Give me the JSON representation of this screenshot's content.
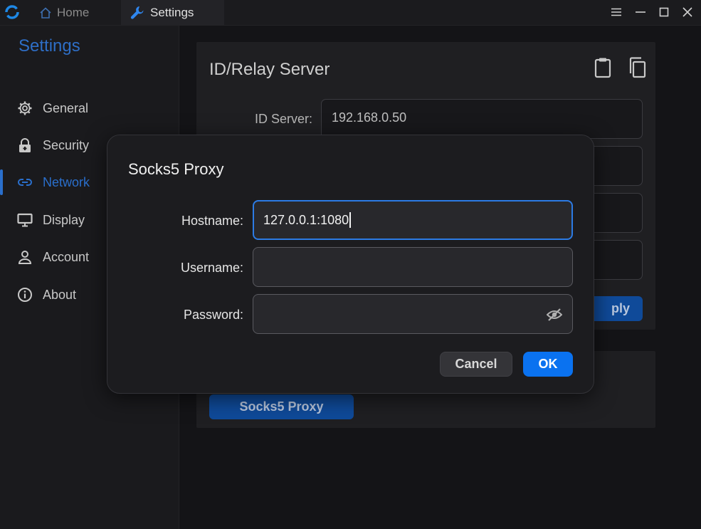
{
  "titlebar": {
    "tabs": [
      {
        "label": "Home",
        "icon": "home-icon"
      },
      {
        "label": "Settings",
        "icon": "wrench-icon"
      }
    ],
    "controls": [
      "menu-icon",
      "minimize-icon",
      "maximize-icon",
      "close-icon"
    ]
  },
  "sidebar": {
    "title": "Settings",
    "items": [
      {
        "label": "General",
        "icon": "gear-icon"
      },
      {
        "label": "Security",
        "icon": "lock-icon"
      },
      {
        "label": "Network",
        "icon": "link-icon",
        "active": true
      },
      {
        "label": "Display",
        "icon": "monitor-icon"
      },
      {
        "label": "Account",
        "icon": "person-icon"
      },
      {
        "label": "About",
        "icon": "info-icon"
      }
    ]
  },
  "server_panel": {
    "title": "ID/Relay Server",
    "id_server_label": "ID Server:",
    "id_server_value": "192.168.0.50",
    "apply_label_visible": "ply"
  },
  "proxy_panel": {
    "button_label": "Socks5 Proxy"
  },
  "dialog": {
    "title": "Socks5 Proxy",
    "hostname_label": "Hostname:",
    "hostname_value": "127.0.0.1:1080",
    "username_label": "Username:",
    "username_value": "",
    "password_label": "Password:",
    "password_value": "",
    "cancel_label": "Cancel",
    "ok_label": "OK"
  },
  "colors": {
    "accent": "#2a6fcc",
    "ok_button": "#0a72f0",
    "background": "#141417"
  }
}
